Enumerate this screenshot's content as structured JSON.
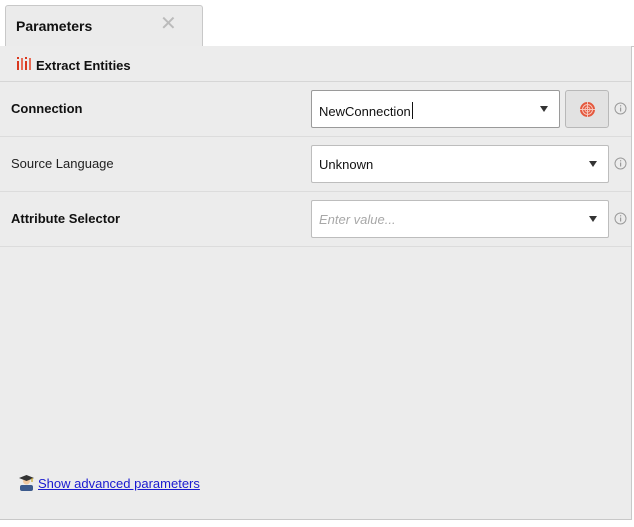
{
  "tab": {
    "label": "Parameters",
    "close_glyph": "✕"
  },
  "operator": {
    "title": "Extract Entities",
    "icon": "extract-entities-icon",
    "icon_color": "#d9381e"
  },
  "parameters": [
    {
      "label": "Connection",
      "value": "NewConnection",
      "placeholder": "",
      "bold": true,
      "has_action_button": true,
      "action_icon": "connection-icon"
    },
    {
      "label": "Source Language",
      "value": "Unknown",
      "placeholder": "",
      "bold": false,
      "has_action_button": false
    },
    {
      "label": "Attribute Selector",
      "value": "",
      "placeholder": "Enter value...",
      "bold": true,
      "has_action_button": false
    }
  ],
  "footer": {
    "advanced_link": "Show advanced parameters",
    "icon": "expert-user-icon"
  },
  "colors": {
    "link": "#1a1ad0",
    "accent": "#d9381e",
    "panel_bg": "#ececec"
  }
}
